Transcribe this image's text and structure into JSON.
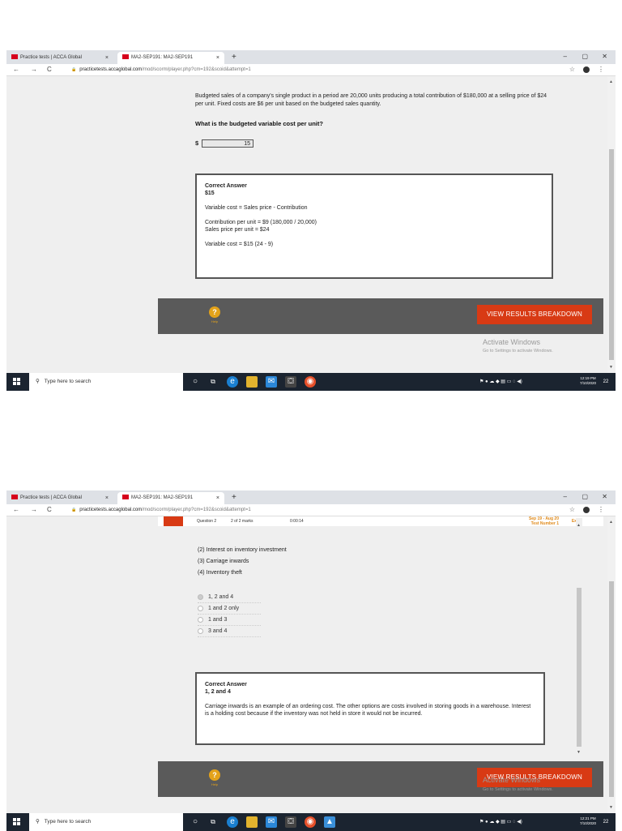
{
  "browser": {
    "tab1_title": "Practice tests | ACCA Global",
    "tab2_title": "MA2-SEP191: MA2-SEP191",
    "tab_close": "×",
    "new_tab": "+",
    "minimize": "–",
    "maximize": "▢",
    "close": "✕",
    "back": "←",
    "forward": "→",
    "reload": "C",
    "lock": "🔒",
    "url_host": "practicetests.accaglobal.com",
    "url_path": "/mod/scorm/player.php?cm=192&scoid&attempt=1",
    "star": "☆",
    "menu": "⋮"
  },
  "screen1": {
    "question_text": "Budgeted sales of a company's single product in a period are 20,000 units producing a total contribution of $180,000 at a selling price of $24 per unit. Fixed costs are $6 per unit based on the budgeted sales quantity.",
    "question_prompt": "What is the budgeted variable cost per unit?",
    "currency": "$",
    "answer_value": "15",
    "correct_title": "Correct Answer",
    "correct_answer": "$15",
    "line1": "Variable cost = Sales price - Contribution",
    "line2a": "Contribution per unit = $9 (180,000 / 20,000)",
    "line2b": "Sales price per unit = $24",
    "line3": "Variable cost = $15 (24 - 9)",
    "help_symbol": "?",
    "help_label": "Help",
    "results_button": "VIEW RESULTS BREAKDOWN",
    "activate_title": "Activate Windows",
    "activate_sub": "Go to Settings to activate Windows.",
    "time": "12:19 PM",
    "date": "7/10/2020"
  },
  "screen2": {
    "banner_question": "Question 2",
    "banner_marks": "2 of 2 marks",
    "banner_timer": "0:00:14",
    "banner_session": "Sep 19 - Aug 20",
    "banner_test": "Test Number 1",
    "banner_exit": "Exit",
    "items": [
      "(2)  Interest on inventory investment",
      "(3)  Carriage inwards",
      "(4)  Inventory theft"
    ],
    "options": [
      "1, 2 and 4",
      "1 and 2 only",
      "1 and 3",
      "3 and 4"
    ],
    "correct_title": "Correct Answer",
    "correct_answer": "1, 2 and 4",
    "explanation": "Carriage inwards is an example of an ordering cost. The other options are costs involved in storing goods in a warehouse. Interest is a holding cost because if the inventory was not held in store it would not be incurred.",
    "help_symbol": "?",
    "help_label": "Help",
    "results_button": "VIEW RESULTS BREAKDOWN",
    "activate_title": "Activate Windows",
    "activate_sub": "Go to Settings to activate Windows.",
    "time": "12:21 PM",
    "date": "7/10/2020"
  },
  "taskbar": {
    "search_placeholder": "Type here to search",
    "search_icon": "⚲",
    "notif_count": "22"
  }
}
